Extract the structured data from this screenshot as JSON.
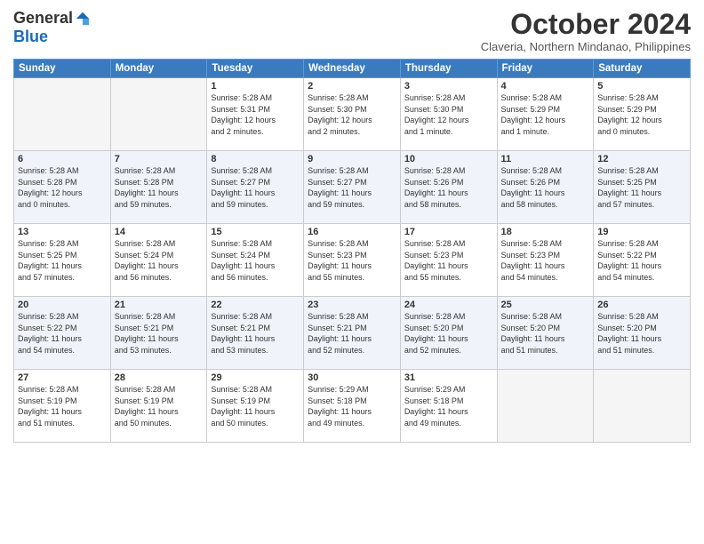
{
  "logo": {
    "general": "General",
    "blue": "Blue"
  },
  "title": "October 2024",
  "subtitle": "Claveria, Northern Mindanao, Philippines",
  "days_of_week": [
    "Sunday",
    "Monday",
    "Tuesday",
    "Wednesday",
    "Thursday",
    "Friday",
    "Saturday"
  ],
  "weeks": [
    [
      {
        "day": "",
        "info": ""
      },
      {
        "day": "",
        "info": ""
      },
      {
        "day": "1",
        "info": "Sunrise: 5:28 AM\nSunset: 5:31 PM\nDaylight: 12 hours\nand 2 minutes."
      },
      {
        "day": "2",
        "info": "Sunrise: 5:28 AM\nSunset: 5:30 PM\nDaylight: 12 hours\nand 2 minutes."
      },
      {
        "day": "3",
        "info": "Sunrise: 5:28 AM\nSunset: 5:30 PM\nDaylight: 12 hours\nand 1 minute."
      },
      {
        "day": "4",
        "info": "Sunrise: 5:28 AM\nSunset: 5:29 PM\nDaylight: 12 hours\nand 1 minute."
      },
      {
        "day": "5",
        "info": "Sunrise: 5:28 AM\nSunset: 5:29 PM\nDaylight: 12 hours\nand 0 minutes."
      }
    ],
    [
      {
        "day": "6",
        "info": "Sunrise: 5:28 AM\nSunset: 5:28 PM\nDaylight: 12 hours\nand 0 minutes."
      },
      {
        "day": "7",
        "info": "Sunrise: 5:28 AM\nSunset: 5:28 PM\nDaylight: 11 hours\nand 59 minutes."
      },
      {
        "day": "8",
        "info": "Sunrise: 5:28 AM\nSunset: 5:27 PM\nDaylight: 11 hours\nand 59 minutes."
      },
      {
        "day": "9",
        "info": "Sunrise: 5:28 AM\nSunset: 5:27 PM\nDaylight: 11 hours\nand 59 minutes."
      },
      {
        "day": "10",
        "info": "Sunrise: 5:28 AM\nSunset: 5:26 PM\nDaylight: 11 hours\nand 58 minutes."
      },
      {
        "day": "11",
        "info": "Sunrise: 5:28 AM\nSunset: 5:26 PM\nDaylight: 11 hours\nand 58 minutes."
      },
      {
        "day": "12",
        "info": "Sunrise: 5:28 AM\nSunset: 5:25 PM\nDaylight: 11 hours\nand 57 minutes."
      }
    ],
    [
      {
        "day": "13",
        "info": "Sunrise: 5:28 AM\nSunset: 5:25 PM\nDaylight: 11 hours\nand 57 minutes."
      },
      {
        "day": "14",
        "info": "Sunrise: 5:28 AM\nSunset: 5:24 PM\nDaylight: 11 hours\nand 56 minutes."
      },
      {
        "day": "15",
        "info": "Sunrise: 5:28 AM\nSunset: 5:24 PM\nDaylight: 11 hours\nand 56 minutes."
      },
      {
        "day": "16",
        "info": "Sunrise: 5:28 AM\nSunset: 5:23 PM\nDaylight: 11 hours\nand 55 minutes."
      },
      {
        "day": "17",
        "info": "Sunrise: 5:28 AM\nSunset: 5:23 PM\nDaylight: 11 hours\nand 55 minutes."
      },
      {
        "day": "18",
        "info": "Sunrise: 5:28 AM\nSunset: 5:23 PM\nDaylight: 11 hours\nand 54 minutes."
      },
      {
        "day": "19",
        "info": "Sunrise: 5:28 AM\nSunset: 5:22 PM\nDaylight: 11 hours\nand 54 minutes."
      }
    ],
    [
      {
        "day": "20",
        "info": "Sunrise: 5:28 AM\nSunset: 5:22 PM\nDaylight: 11 hours\nand 54 minutes."
      },
      {
        "day": "21",
        "info": "Sunrise: 5:28 AM\nSunset: 5:21 PM\nDaylight: 11 hours\nand 53 minutes."
      },
      {
        "day": "22",
        "info": "Sunrise: 5:28 AM\nSunset: 5:21 PM\nDaylight: 11 hours\nand 53 minutes."
      },
      {
        "day": "23",
        "info": "Sunrise: 5:28 AM\nSunset: 5:21 PM\nDaylight: 11 hours\nand 52 minutes."
      },
      {
        "day": "24",
        "info": "Sunrise: 5:28 AM\nSunset: 5:20 PM\nDaylight: 11 hours\nand 52 minutes."
      },
      {
        "day": "25",
        "info": "Sunrise: 5:28 AM\nSunset: 5:20 PM\nDaylight: 11 hours\nand 51 minutes."
      },
      {
        "day": "26",
        "info": "Sunrise: 5:28 AM\nSunset: 5:20 PM\nDaylight: 11 hours\nand 51 minutes."
      }
    ],
    [
      {
        "day": "27",
        "info": "Sunrise: 5:28 AM\nSunset: 5:19 PM\nDaylight: 11 hours\nand 51 minutes."
      },
      {
        "day": "28",
        "info": "Sunrise: 5:28 AM\nSunset: 5:19 PM\nDaylight: 11 hours\nand 50 minutes."
      },
      {
        "day": "29",
        "info": "Sunrise: 5:28 AM\nSunset: 5:19 PM\nDaylight: 11 hours\nand 50 minutes."
      },
      {
        "day": "30",
        "info": "Sunrise: 5:29 AM\nSunset: 5:18 PM\nDaylight: 11 hours\nand 49 minutes."
      },
      {
        "day": "31",
        "info": "Sunrise: 5:29 AM\nSunset: 5:18 PM\nDaylight: 11 hours\nand 49 minutes."
      },
      {
        "day": "",
        "info": ""
      },
      {
        "day": "",
        "info": ""
      }
    ]
  ]
}
